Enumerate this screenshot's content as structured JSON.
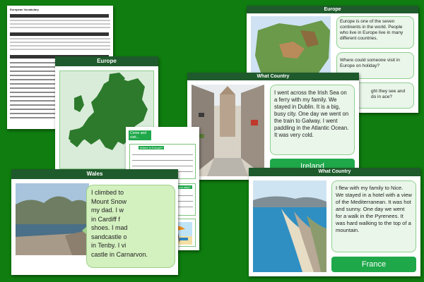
{
  "knowledge_organiser": {
    "title": "European Vocabulary"
  },
  "europe_map_sheet": {
    "header": "Europe"
  },
  "europe_questions_sheet": {
    "header": "Europe",
    "card1": "Europe is one of the seven continents in the world. People who live in Europe live in many different countries.",
    "card2": "Where could someone visit in Europe on holiday?",
    "card3_partial": "ght they see and do in ace?"
  },
  "ireland_sheet": {
    "header": "What Country",
    "text": "I went across the Irish Sea on a ferry with my family. We stayed in Dublin. It is a big, busy city. One day we went on the train to Galway. I went paddling in the Atlantic Ocean. It was very cold.",
    "answer": "Ireland"
  },
  "worksheet": {
    "top_label": "Come and visit...",
    "q1": "Where in Europe?",
    "q2": "Where can you stay?",
    "q3": "Where can you visit?"
  },
  "wales_sheet": {
    "header": "Wales",
    "text_lines": [
      "I climbed to",
      "Mount Snow",
      "my dad. I w",
      "in Cardiff f",
      "shoes. I mad",
      "sandcastle o",
      "in Tenby. I vi",
      "castle in Carnarvon."
    ]
  },
  "france_sheet": {
    "header": "What Country",
    "text": "I flew with my family to Nice. We stayed in a hotel with a view of the Mediterranean.  It was hot and sunny. One day we went for a walk in the Pyrenees. It was hard walking to the top of a mountain.",
    "answer": "France"
  }
}
